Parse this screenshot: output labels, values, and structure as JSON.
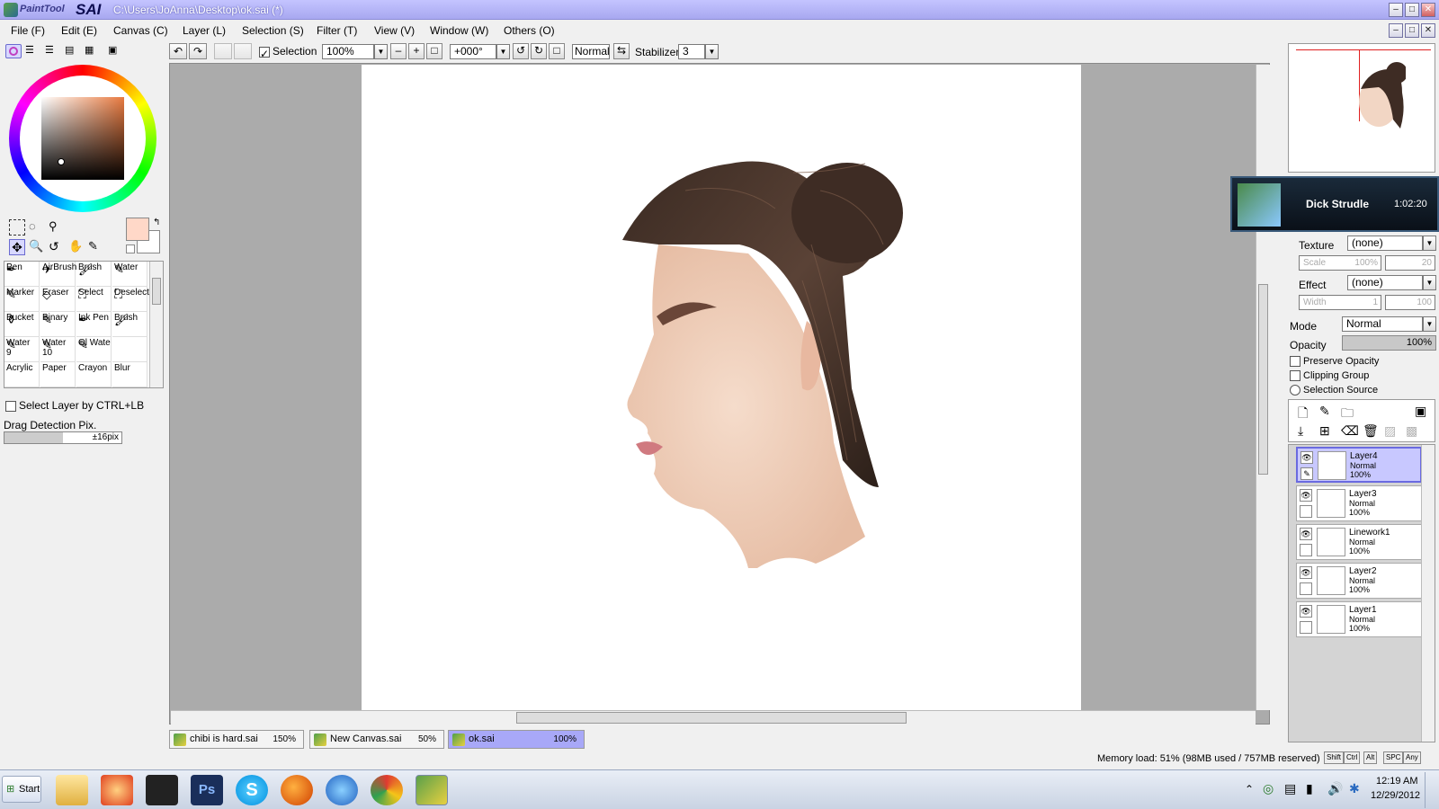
{
  "window": {
    "app_name_small": "PaintTool",
    "app_name_big": "SAI",
    "title": "C:\\Users\\JoAnna\\Desktop\\ok.sai (*)"
  },
  "menu": [
    "File (F)",
    "Edit (E)",
    "Canvas (C)",
    "Layer (L)",
    "Selection (S)",
    "Filter (T)",
    "View (V)",
    "Window (W)",
    "Others (O)"
  ],
  "toolbar": {
    "selection_label": "Selection",
    "zoom": "100%",
    "rotation": "+000°",
    "blend": "Normal",
    "stabilizer_label": "Stabilizer",
    "stabilizer_value": "3"
  },
  "colors": {
    "primary": "#ffd8c8",
    "secondary": "#ffffff"
  },
  "tools": [
    {
      "label": "Pen",
      "icon": "pen-icon"
    },
    {
      "label": "AirBrush",
      "icon": "airbrush-icon"
    },
    {
      "label": "Brush",
      "icon": "brush-icon"
    },
    {
      "label": "Water",
      "icon": "water-icon"
    },
    {
      "label": "Marker",
      "icon": "marker-icon"
    },
    {
      "label": "Eraser",
      "icon": "eraser-icon"
    },
    {
      "label": "Select",
      "icon": "select-icon"
    },
    {
      "label": "Deselect",
      "icon": "deselect-icon"
    },
    {
      "label": "Bucket",
      "icon": "bucket-icon"
    },
    {
      "label": "Binary",
      "icon": "binary-icon"
    },
    {
      "label": "Ink Pen",
      "icon": "ink-pen-icon"
    },
    {
      "label": "Brush",
      "icon": "brush-icon"
    },
    {
      "label": "Water\n9",
      "icon": "water-icon"
    },
    {
      "label": "Water\n10",
      "icon": "water-icon"
    },
    {
      "label": "Ol Wate",
      "icon": "oil-water-icon"
    },
    {
      "label": "",
      "icon": ""
    },
    {
      "label": "Acrylic",
      "icon": ""
    },
    {
      "label": "Paper",
      "icon": ""
    },
    {
      "label": "Crayon",
      "icon": ""
    },
    {
      "label": "Blur",
      "icon": ""
    }
  ],
  "left_options": {
    "select_layer_label": "Select Layer by CTRL+LB",
    "drag_detection_label": "Drag Detection Pix.",
    "drag_detection_value": "±16pix",
    "drag_detection_level": 0.5
  },
  "brush_panel": {
    "texture_label": "Texture",
    "texture_value": "(none)",
    "scale_label": "Scale",
    "scale_value": "100%",
    "scale_num": "20",
    "effect_label": "Effect",
    "effect_value": "(none)",
    "width_label": "Width",
    "width_value": "1",
    "width_num": "100"
  },
  "layer_panel": {
    "mode_label": "Mode",
    "mode_value": "Normal",
    "opacity_label": "Opacity",
    "opacity_value": "100%",
    "preserve_opacity": "Preserve Opacity",
    "clipping_group": "Clipping Group",
    "selection_source": "Selection Source",
    "layers": [
      {
        "name": "Layer4",
        "mode": "Normal",
        "opacity": "100%",
        "selected": true
      },
      {
        "name": "Layer3",
        "mode": "Normal",
        "opacity": "100%",
        "selected": false
      },
      {
        "name": "Linework1",
        "mode": "Normal",
        "opacity": "100%",
        "selected": false
      },
      {
        "name": "Layer2",
        "mode": "Normal",
        "opacity": "100%",
        "selected": false
      },
      {
        "name": "Layer1",
        "mode": "Normal",
        "opacity": "100%",
        "selected": false
      }
    ]
  },
  "notification": {
    "name": "Dick Strudle",
    "time": "1:02:20"
  },
  "tabs": [
    {
      "name": "chibi is hard.sai",
      "zoom": "150%",
      "active": false
    },
    {
      "name": "New Canvas.sai",
      "zoom": "50%",
      "active": false
    },
    {
      "name": "ok.sai",
      "zoom": "100%",
      "active": true
    }
  ],
  "status": {
    "memory": "Memory load: 51% (98MB used / 757MB reserved)",
    "keys": [
      "Shift",
      "Ctrl",
      "Alt",
      "SPC",
      "Any"
    ]
  },
  "taskbar": {
    "start_label": "Start",
    "time": "12:19 AM",
    "date": "12/29/2012"
  }
}
